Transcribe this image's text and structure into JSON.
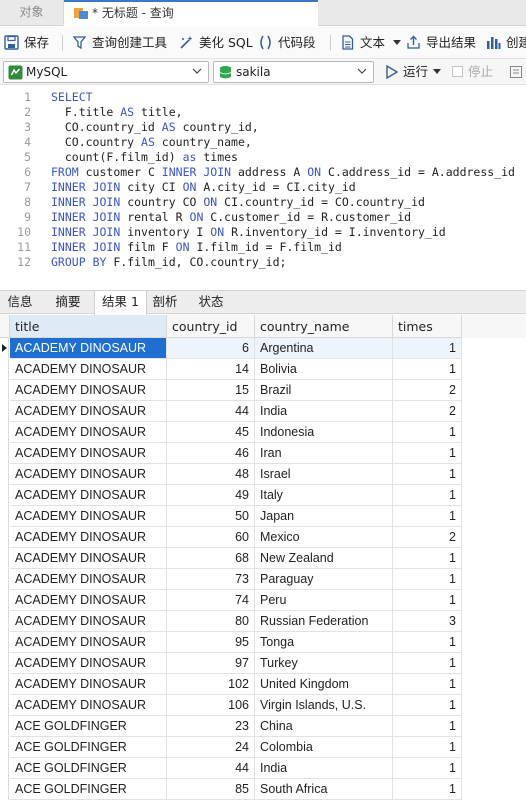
{
  "tabs": {
    "objects": "对象",
    "query": "* 无标题 - 查询"
  },
  "toolbar": {
    "save": "保存",
    "query_builder": "查询创建工具",
    "beautify_sql": "美化 SQL",
    "code_snippet": "代码段",
    "text": "文本",
    "export_result": "导出结果",
    "create": "创建"
  },
  "connection": {
    "db_type": "MySQL",
    "database": "sakila",
    "run": "运行",
    "stop": "停止"
  },
  "editor": {
    "lines": [
      {
        "n": "1",
        "code": "SELECT"
      },
      {
        "n": "2",
        "code": "  F.title AS title,"
      },
      {
        "n": "3",
        "code": "  CO.country_id AS country_id,"
      },
      {
        "n": "4",
        "code": "  CO.country AS country_name,"
      },
      {
        "n": "5",
        "code": "  count(F.film_id) as times"
      },
      {
        "n": "6",
        "code": "FROM customer C INNER JOIN address A ON C.address_id = A.address_id"
      },
      {
        "n": "7",
        "code": "INNER JOIN city CI ON A.city_id = CI.city_id"
      },
      {
        "n": "8",
        "code": "INNER JOIN country CO ON CI.country_id = CO.country_id"
      },
      {
        "n": "9",
        "code": "INNER JOIN rental R ON C.customer_id = R.customer_id"
      },
      {
        "n": "10",
        "code": "INNER JOIN inventory I ON R.inventory_id = I.inventory_id"
      },
      {
        "n": "11",
        "code": "INNER JOIN film F ON I.film_id = F.film_id"
      },
      {
        "n": "12",
        "code": "GROUP BY F.film_id, CO.country_id;"
      }
    ]
  },
  "result_tabs": [
    "信息",
    "摘要",
    "结果 1",
    "剖析",
    "状态"
  ],
  "grid": {
    "columns": [
      "title",
      "country_id",
      "country_name",
      "times"
    ],
    "rows": [
      [
        "ACADEMY DINOSAUR",
        "6",
        "Argentina",
        "1"
      ],
      [
        "ACADEMY DINOSAUR",
        "14",
        "Bolivia",
        "1"
      ],
      [
        "ACADEMY DINOSAUR",
        "15",
        "Brazil",
        "2"
      ],
      [
        "ACADEMY DINOSAUR",
        "44",
        "India",
        "2"
      ],
      [
        "ACADEMY DINOSAUR",
        "45",
        "Indonesia",
        "1"
      ],
      [
        "ACADEMY DINOSAUR",
        "46",
        "Iran",
        "1"
      ],
      [
        "ACADEMY DINOSAUR",
        "48",
        "Israel",
        "1"
      ],
      [
        "ACADEMY DINOSAUR",
        "49",
        "Italy",
        "1"
      ],
      [
        "ACADEMY DINOSAUR",
        "50",
        "Japan",
        "1"
      ],
      [
        "ACADEMY DINOSAUR",
        "60",
        "Mexico",
        "2"
      ],
      [
        "ACADEMY DINOSAUR",
        "68",
        "New Zealand",
        "1"
      ],
      [
        "ACADEMY DINOSAUR",
        "73",
        "Paraguay",
        "1"
      ],
      [
        "ACADEMY DINOSAUR",
        "74",
        "Peru",
        "1"
      ],
      [
        "ACADEMY DINOSAUR",
        "80",
        "Russian Federation",
        "3"
      ],
      [
        "ACADEMY DINOSAUR",
        "95",
        "Tonga",
        "1"
      ],
      [
        "ACADEMY DINOSAUR",
        "97",
        "Turkey",
        "1"
      ],
      [
        "ACADEMY DINOSAUR",
        "102",
        "United Kingdom",
        "1"
      ],
      [
        "ACADEMY DINOSAUR",
        "106",
        "Virgin Islands, U.S.",
        "1"
      ],
      [
        "ACE GOLDFINGER",
        "23",
        "China",
        "1"
      ],
      [
        "ACE GOLDFINGER",
        "24",
        "Colombia",
        "1"
      ],
      [
        "ACE GOLDFINGER",
        "44",
        "India",
        "1"
      ],
      [
        "ACE GOLDFINGER",
        "85",
        "South Africa",
        "1"
      ]
    ]
  }
}
